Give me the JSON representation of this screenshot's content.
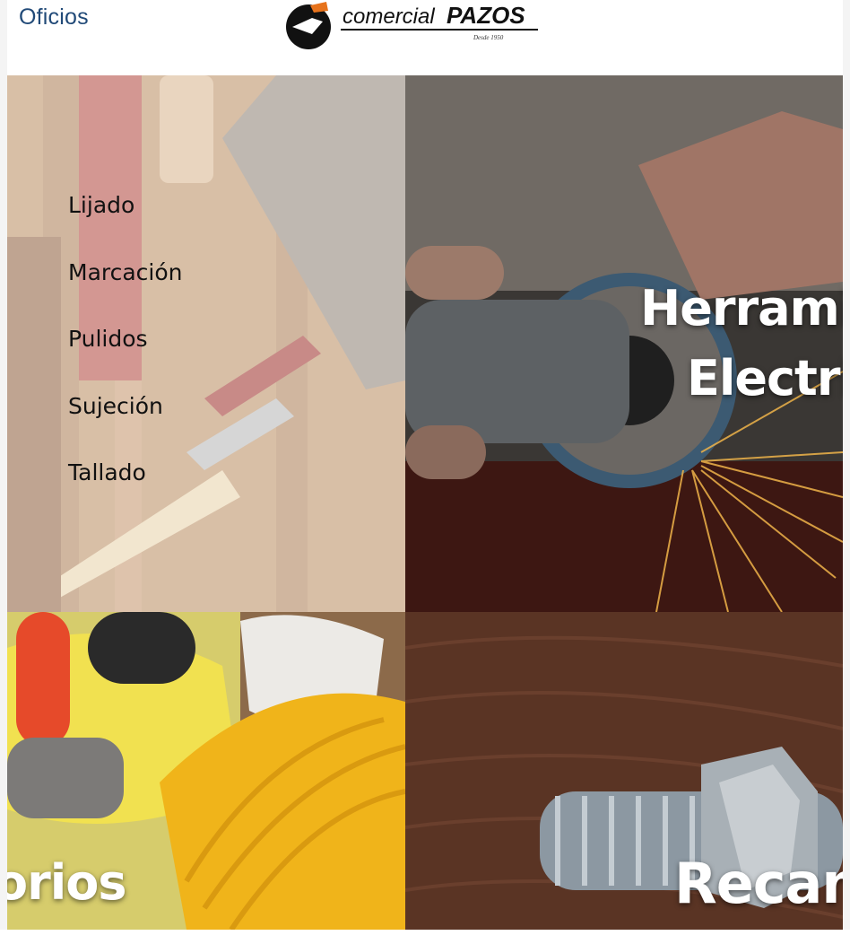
{
  "header": {
    "nav_link": "Oficios",
    "logo": {
      "brand_prefix": "comercial",
      "brand_name": "PAZOS",
      "tagline": "Desde 1950",
      "colors": {
        "orange": "#e7731c",
        "black": "#111111"
      }
    }
  },
  "tiles": {
    "hand_tools": {
      "menu": [
        "Lijado",
        "Marcación",
        "Pulidos",
        "Sujeción",
        "Tallado"
      ]
    },
    "power_tools": {
      "label_line1": "Herrami",
      "label_line2": "Electri"
    },
    "safety": {
      "label": "orios"
    },
    "spare_parts": {
      "label": "Recam"
    }
  },
  "colors": {
    "link": "#214a78",
    "label_text": "#ffffff"
  }
}
